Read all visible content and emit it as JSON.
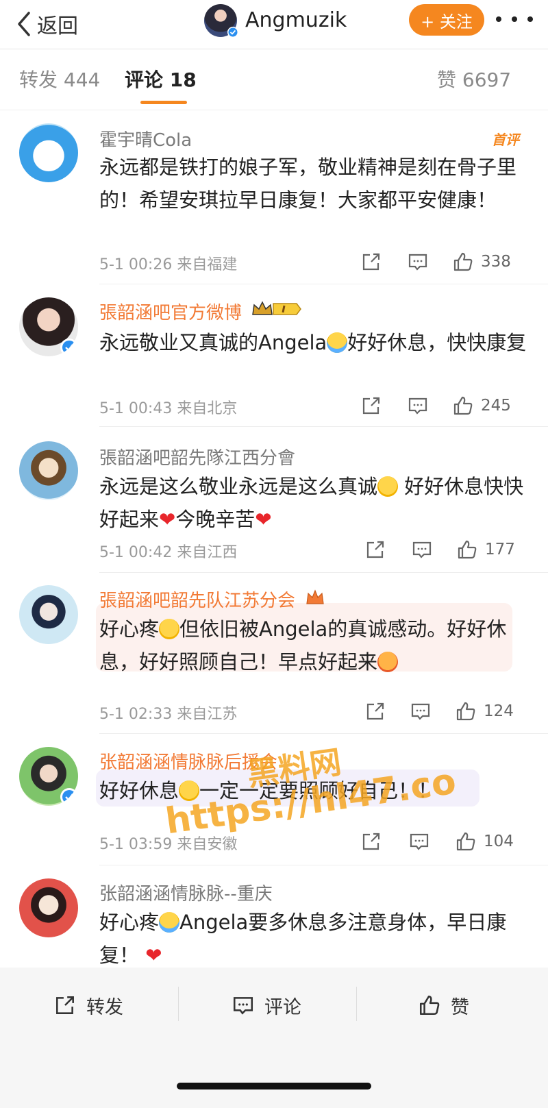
{
  "topbar": {
    "back_label": "返回",
    "title": "Angmuzik",
    "follow_label": "+ 关注"
  },
  "tabs": [
    {
      "label": "转发",
      "count": "444"
    },
    {
      "label": "评论",
      "count": "18"
    },
    {
      "label": "赞",
      "count": "6697"
    }
  ],
  "comments": [
    {
      "name": "霍宇晴Cola",
      "badge": "首评",
      "text": "永远都是铁打的娘子军，敬业精神是刻在骨子里的！希望安琪拉早日康复！大家都平安健康！",
      "time": "5-1 00:26",
      "location": "来自福建",
      "likes": "338"
    },
    {
      "name": "張韶涵吧官方微博",
      "text_a": "永远敬业又真诚的Angela",
      "text_b": "好好休息，快快康复",
      "time": "5-1 00:43",
      "location": "来自北京",
      "likes": "245"
    },
    {
      "name": "張韶涵吧韶先隊江西分會",
      "text_a": "永远是这么敬业永远是这么真诚",
      "text_b": " 好好休息快快好起来",
      "text_c": "今晚辛苦",
      "time": "5-1 00:42",
      "location": "来自江西",
      "likes": "177"
    },
    {
      "name": "張韶涵吧韶先队江苏分会",
      "text_a": "好心疼",
      "text_b": "但依旧被Angela的真诚感动。好好休息，好好照顾自己！早点好起来",
      "time": "5-1 02:33",
      "location": "来自江苏",
      "likes": "124"
    },
    {
      "name": "张韶涵涵情脉脉后援会",
      "text_a": "好好休息",
      "text_b": "一定一定要照顾好自己！！",
      "time": "5-1 03:59",
      "location": "来自安徽",
      "likes": "104"
    },
    {
      "name": "张韶涵涵情脉脉--重庆",
      "text_a": "好心疼",
      "text_b": "Angela要多休息多注意身体，早日康复！",
      "time": "",
      "location": "",
      "likes": ""
    }
  ],
  "watermark": {
    "line1": "黑料网",
    "line2": "https://hl47.co"
  },
  "bottombar": {
    "repost_label": "转发",
    "comment_label": "评论",
    "like_label": "赞"
  },
  "colors": {
    "accent": "#f5871f",
    "name_orange": "#f27a35",
    "heart": "#e8262b"
  }
}
